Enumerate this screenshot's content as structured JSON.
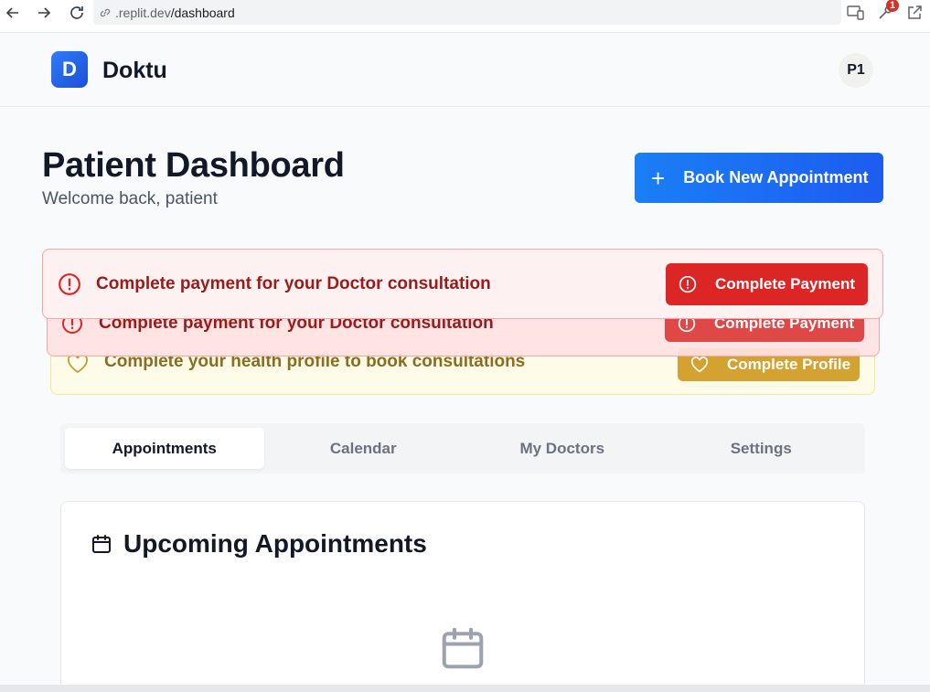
{
  "browser": {
    "url_host": ".replit.dev",
    "url_path": "/dashboard",
    "extension_badge": "1"
  },
  "header": {
    "logo_letter": "D",
    "brand": "Doktu",
    "avatar_initials": "P1"
  },
  "page": {
    "title": "Patient Dashboard",
    "subtitle": "Welcome back, patient",
    "book_button_label": "Book New Appointment"
  },
  "alerts": {
    "payment_primary": {
      "message": "Complete payment for your Doctor consultation",
      "button_label": "Complete Payment"
    },
    "payment_secondary": {
      "message": "Complete payment for your Doctor consultation",
      "button_label": "Complete Payment"
    },
    "profile": {
      "message": "Complete your health profile to book consultations",
      "button_label": "Complete Profile"
    }
  },
  "tabs": [
    {
      "label": "Appointments",
      "active": true
    },
    {
      "label": "Calendar",
      "active": false
    },
    {
      "label": "My Doctors",
      "active": false
    },
    {
      "label": "Settings",
      "active": false
    }
  ],
  "appointments_card": {
    "title": "Upcoming Appointments"
  },
  "colors": {
    "primary": "#1d5cf0",
    "danger": "#dc2626",
    "warning": "#d4a231"
  }
}
